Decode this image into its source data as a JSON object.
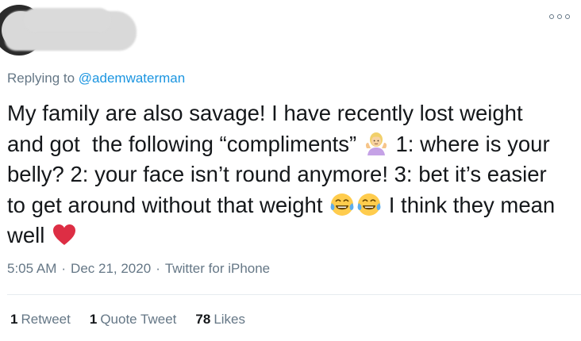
{
  "author": {
    "avatar_icon": "avatar",
    "name_redacted": true
  },
  "menu": {
    "more_icon": "more-horizontal-icon"
  },
  "reply": {
    "prefix": "Replying to ",
    "handle": "@ademwaterman"
  },
  "tweet": {
    "text_1": "My family are also savage! I have recently lost weight and got  the following “compliments” ",
    "emoji_1": "person-shrugging-emoji",
    "text_2": " 1: where is your belly? 2: your face isn’t round anymore! 3: bet it’s easier to get around without that weight ",
    "emoji_2": "face-with-tears-of-joy-emoji",
    "emoji_3": "face-with-tears-of-joy-emoji",
    "text_3": " I think they mean well ",
    "emoji_4": "red-heart-emoji"
  },
  "meta": {
    "time": "5:05 AM",
    "separator": "·",
    "date": "Dec 21, 2020",
    "source": "Twitter for iPhone"
  },
  "stats": {
    "retweets_count": "1",
    "retweets_label": "Retweet",
    "quotes_count": "1",
    "quotes_label": "Quote Tweet",
    "likes_count": "78",
    "likes_label": "Likes"
  },
  "colors": {
    "link": "#1b95e0",
    "secondary_text": "#657786",
    "primary_text": "#14171a",
    "divider": "#e6ecf0",
    "heart": "#e0245e"
  }
}
